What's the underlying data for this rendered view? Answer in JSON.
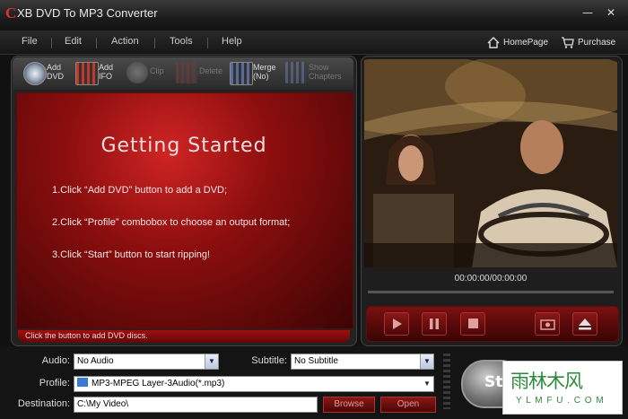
{
  "window": {
    "logo_letter": "C",
    "title": "XB DVD To MP3 Converter"
  },
  "menu": {
    "items": [
      "File",
      "Edit",
      "Action",
      "Tools",
      "Help"
    ],
    "homepage": "HomePage",
    "purchase": "Purchase"
  },
  "toolbar": {
    "add_dvd": [
      "Add",
      "DVD"
    ],
    "add_ifo": [
      "Add",
      "IFO"
    ],
    "clip": "Clip",
    "delete": "Delete",
    "merge": [
      "Merge",
      "(No)"
    ],
    "show_chapters": [
      "Show",
      "Chapters"
    ]
  },
  "getting_started": {
    "title": "Getting  Started",
    "steps": [
      "1.Click “Add DVD” button to add a DVD;",
      "2.Click “Profile” combobox to choose an output format;",
      "3.Click “Start” button to start ripping!"
    ]
  },
  "status": "Click the button to add DVD discs.",
  "player": {
    "time": "00:00:00/00:00:00",
    "seek_progress": 0
  },
  "settings": {
    "audio_label": "Audio:",
    "audio_value": "No Audio",
    "subtitle_label": "Subtitle:",
    "subtitle_value": "No Subtitle",
    "profile_label": "Profile:",
    "profile_value": "MP3-MPEG Layer-3Audio(*.mp3)",
    "destination_label": "Destination:",
    "destination_value": "C:\\My Video\\",
    "browse": "Browse",
    "open": "Open",
    "start": "St"
  },
  "watermark": {
    "cn": "雨林木风",
    "en": "Y L M F U . C O M"
  },
  "colors": {
    "accent": "#b01414",
    "status": "#8a0c0c"
  }
}
